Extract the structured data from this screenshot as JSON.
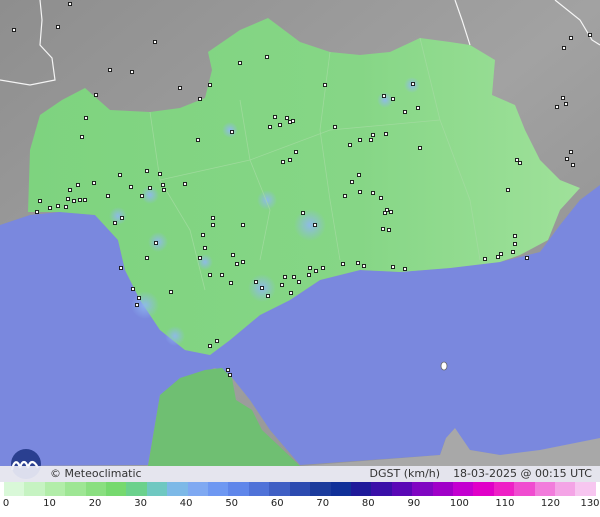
{
  "brand": "© Meteoclimatic",
  "variable_label": "DGST (km/h)",
  "timestamp": "18-03-2025 @ 00:15 UTC",
  "legend": {
    "ticks": [
      "0",
      "10",
      "20",
      "30",
      "40",
      "50",
      "60",
      "70",
      "80",
      "90",
      "100",
      "110",
      "120",
      "130"
    ],
    "colors": [
      "#d9f8d8",
      "#c6f3c2",
      "#b2eda9",
      "#9ee694",
      "#8adf80",
      "#76d96e",
      "#6bd18c",
      "#6fc8c1",
      "#7db9e7",
      "#7fa9f2",
      "#6e98f2",
      "#5f86ea",
      "#4f72d8",
      "#3f5fc4",
      "#2c4bb0",
      "#1b3b9c",
      "#103098",
      "#1f1a9a",
      "#3a0fa8",
      "#5a08b6",
      "#8006c2",
      "#a000c8",
      "#c300d0",
      "#e000c8",
      "#ee20c6",
      "#f04cd0",
      "#f27cdc",
      "#f4a4e6",
      "#f7c6f0"
    ]
  },
  "colors": {
    "sea": "#7a88de",
    "land_green": "#7fd17f",
    "mountain": "#9a9a9a"
  }
}
